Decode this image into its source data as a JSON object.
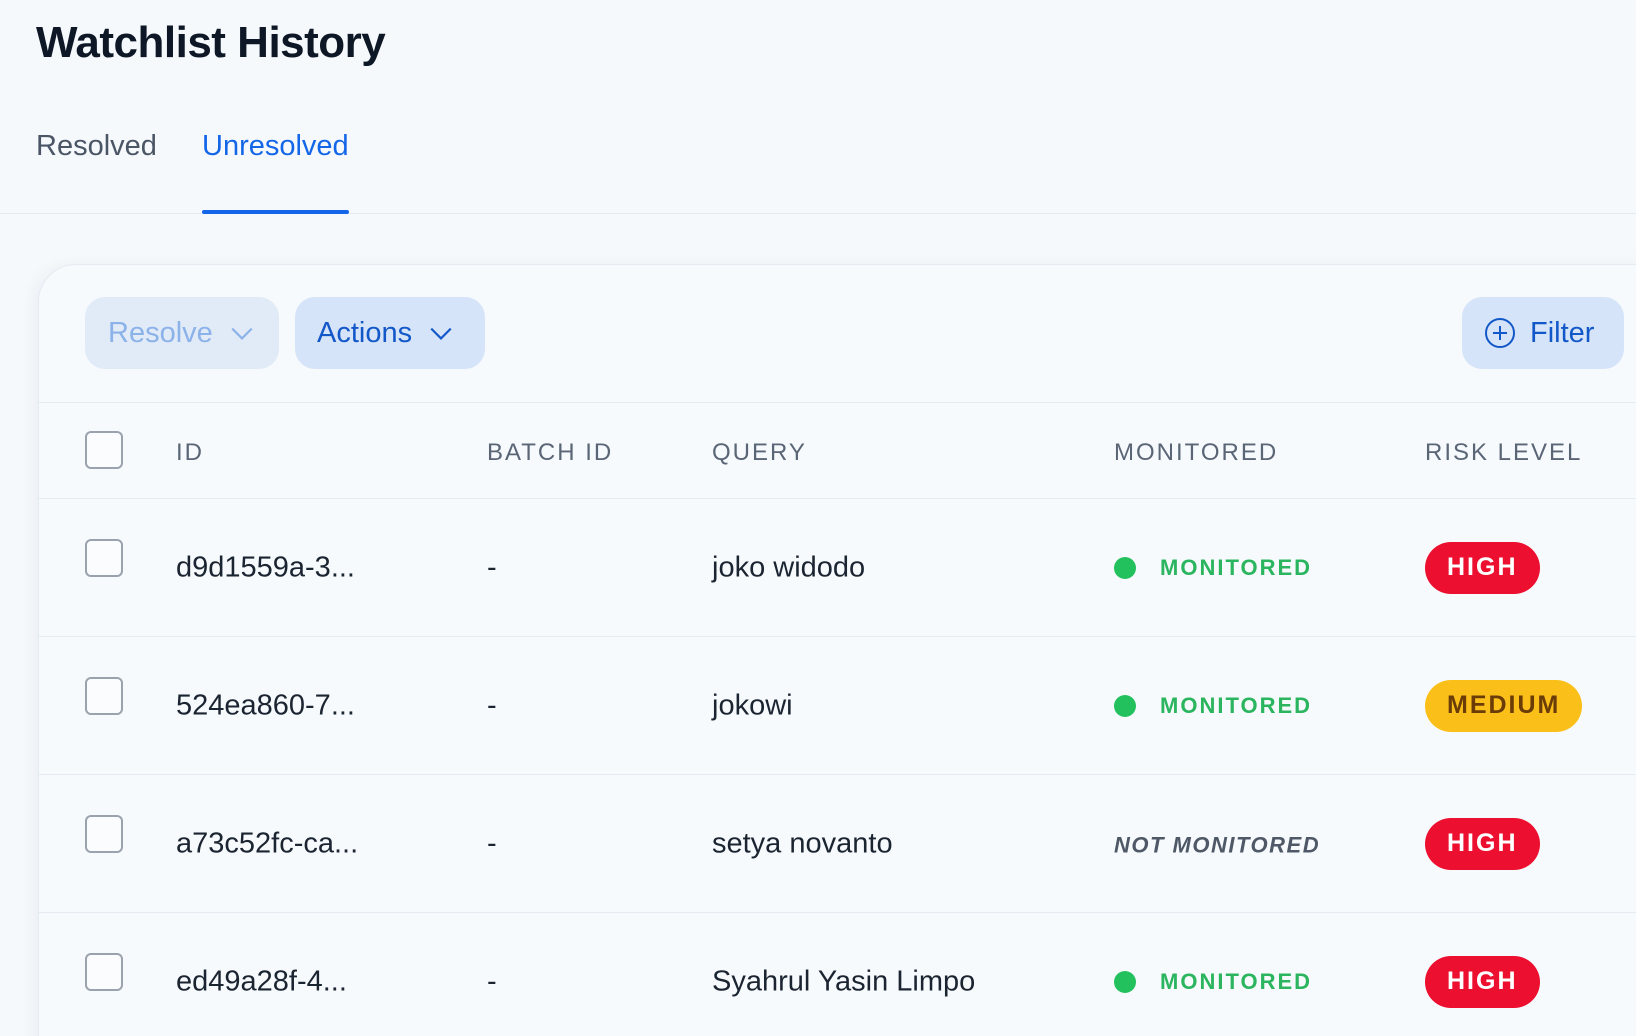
{
  "page": {
    "title": "Watchlist History"
  },
  "tabs": [
    {
      "label": "Resolved",
      "active": false
    },
    {
      "label": "Unresolved",
      "active": true
    }
  ],
  "toolbar": {
    "resolve_label": "Resolve",
    "actions_label": "Actions",
    "filter_label": "Filter"
  },
  "table": {
    "columns": [
      "ID",
      "BATCH ID",
      "QUERY",
      "MONITORED",
      "RISK LEVEL"
    ],
    "rows": [
      {
        "id": "d9d1559a-3...",
        "batch_id": "-",
        "query": "joko widodo",
        "monitored": "MONITORED",
        "is_monitored": true,
        "risk": "HIGH"
      },
      {
        "id": "524ea860-7...",
        "batch_id": "-",
        "query": "jokowi",
        "monitored": "MONITORED",
        "is_monitored": true,
        "risk": "MEDIUM"
      },
      {
        "id": "a73c52fc-ca...",
        "batch_id": "-",
        "query": "setya novanto",
        "monitored": "NOT MONITORED",
        "is_monitored": false,
        "risk": "HIGH"
      },
      {
        "id": "ed49a28f-4...",
        "batch_id": "-",
        "query": "Syahrul Yasin Limpo",
        "monitored": "MONITORED",
        "is_monitored": true,
        "risk": "HIGH"
      }
    ]
  },
  "colors": {
    "accent": "#1466e8",
    "monitored": "#22c15e",
    "risk_high": "#ec0f2f",
    "risk_medium": "#fbbf1a"
  }
}
